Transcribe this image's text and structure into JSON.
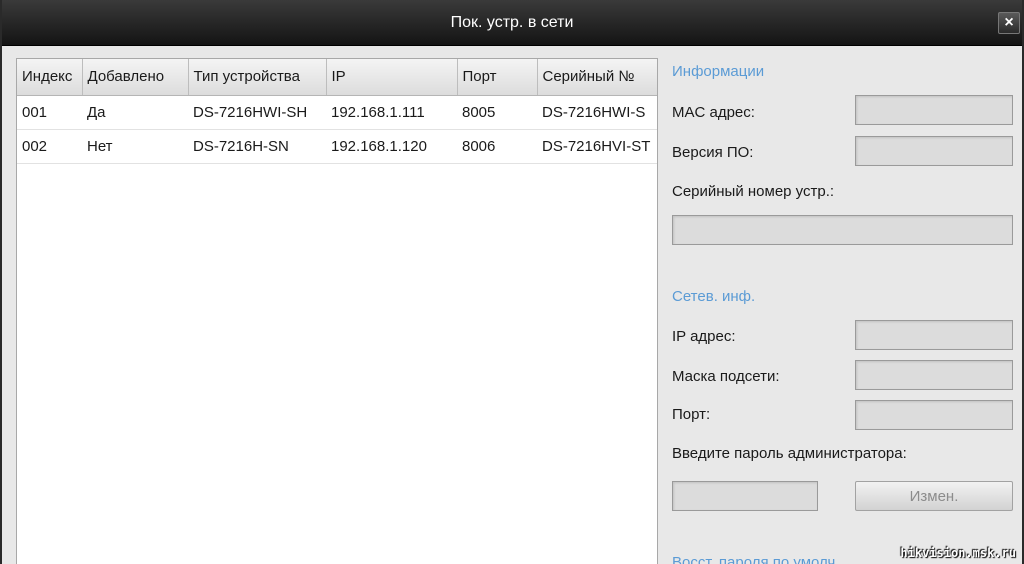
{
  "window": {
    "title": "Пок. устр. в сети",
    "close_glyph": "×"
  },
  "table": {
    "columns": [
      "Индекс",
      "Добавлено",
      "Тип устройства",
      "IP",
      "Порт",
      "Серийный №"
    ],
    "rows": [
      [
        "001",
        "Да",
        "DS-7216HWI-SH",
        "192.168.1.111",
        "8005",
        "DS-7216HWI-S"
      ],
      [
        "002",
        "Нет",
        "DS-7216H-SN",
        "192.168.1.120",
        "8006",
        "DS-7216HVI-ST"
      ]
    ]
  },
  "info": {
    "section_title": "Информации",
    "mac_label": "MAC адрес:",
    "mac_value": "",
    "firmware_label": "Версия ПО:",
    "firmware_value": "",
    "serial_label": "Серийный номер устр.:",
    "serial_value": ""
  },
  "network": {
    "section_title": "Сетев. инф.",
    "ip_label": "IP адрес:",
    "ip_value": "",
    "mask_label": "Маска подсети:",
    "mask_value": "",
    "port_label": "Порт:",
    "port_value": "",
    "password_label": "Введите пароль администратора:",
    "password_value": "",
    "change_button": "Измен."
  },
  "restore": {
    "section_title": "Восст. пароля по умолч."
  },
  "watermark": "hikvision.msk.ru",
  "colors": {
    "section_title": "#5b9bd5",
    "titlebar": "#1e1e1e",
    "panel_bg": "#e8e8e8"
  }
}
